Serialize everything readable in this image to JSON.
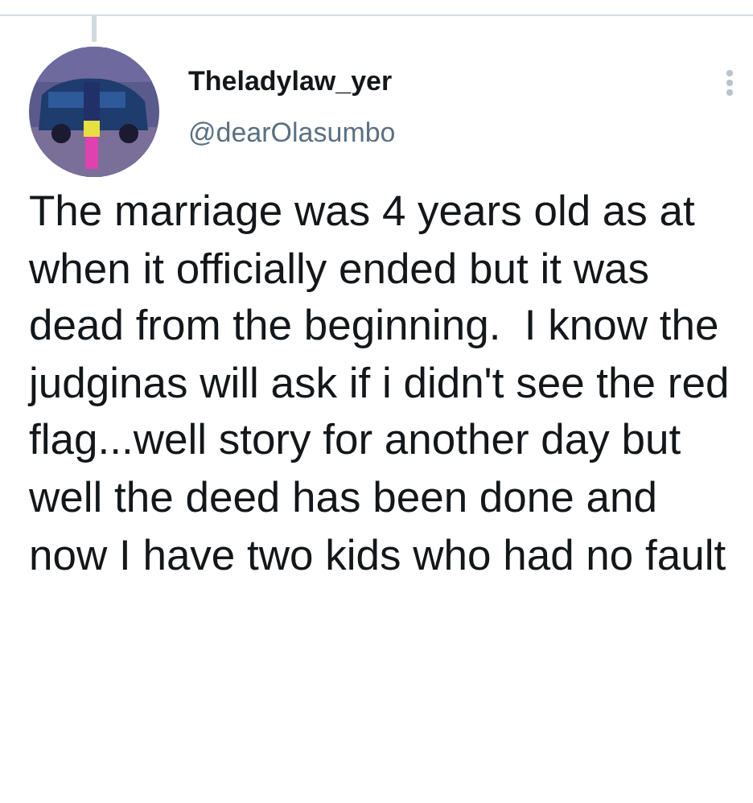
{
  "tweet": {
    "display_name": "Theladylaw_yer",
    "handle": "@dearOlasumbo",
    "text": "The marriage was 4 years old as at when it officially ended but it was dead from the beginning.  I know the judginas will ask if i didn't see the red flag...well story for another day but well the deed has been done and now I have two kids who had no fault"
  }
}
